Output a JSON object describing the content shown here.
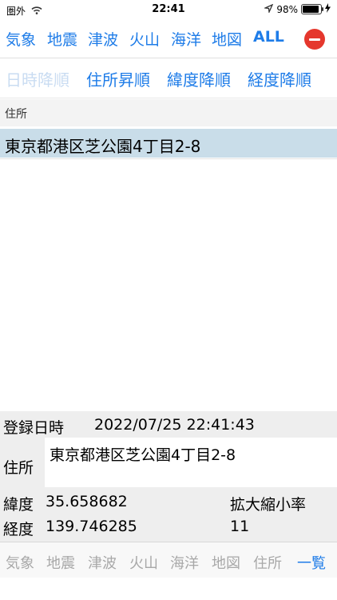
{
  "status_bar": {
    "carrier": "圏外",
    "time": "22:41",
    "battery": "98%"
  },
  "top_tabs": [
    "気象",
    "地震",
    "津波",
    "火山",
    "海洋",
    "地図",
    "ALL"
  ],
  "sort_tabs": [
    "日時降順",
    "住所昇順",
    "緯度降順",
    "経度降順"
  ],
  "list": {
    "header": "住所",
    "items": [
      "東京都港区芝公園4丁目2-8"
    ]
  },
  "detail": {
    "registered_label": "登録日時",
    "registered_value": "2022/07/25 22:41:43",
    "address_label": "住所",
    "address_value": "東京都港区芝公園4丁目2-8",
    "latitude_label": "緯度",
    "latitude_value": "35.658682",
    "zoom_label": "拡大縮小率",
    "longitude_label": "経度",
    "longitude_value": "139.746285",
    "zoom_value": "11"
  },
  "bottom_tabs": [
    "気象",
    "地震",
    "津波",
    "火山",
    "海洋",
    "地図",
    "住所",
    "一覧"
  ],
  "colors": {
    "accent": "#1e7ce8",
    "selected_row": "#c9dde9",
    "remove": "#e5372d"
  }
}
